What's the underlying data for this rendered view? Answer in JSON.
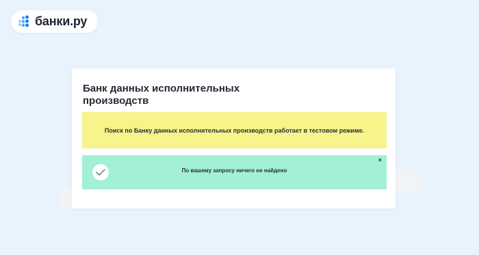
{
  "brand": {
    "name": "банки.ру",
    "accent": "#1e7ef0",
    "icon": "dots-logo-icon"
  },
  "background_color": "#e9f3fd",
  "card": {
    "title": "Банк данных исполнительных производств",
    "notice": {
      "text": "Поиск по Банку данных исполнительных производств работает в тестовом режиме.",
      "color": "#f6f48a"
    },
    "result": {
      "text": "По вашему запросу ничего не найдено",
      "color": "#a2f1d5",
      "icon": "check-icon",
      "close_icon": "close-icon",
      "close_glyph": "×"
    }
  }
}
